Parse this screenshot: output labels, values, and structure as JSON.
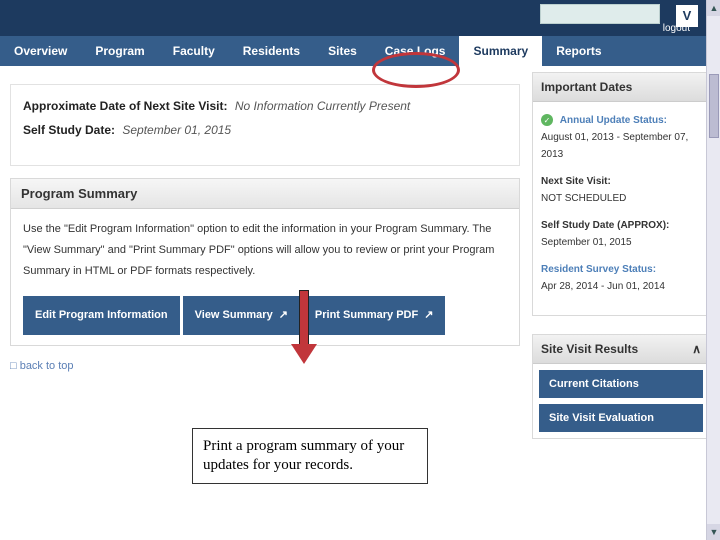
{
  "topbar": {
    "logout": "logout",
    "v": "V"
  },
  "nav": {
    "tabs": [
      "Overview",
      "Program",
      "Faculty",
      "Residents",
      "Sites",
      "Case Logs",
      "Summary",
      "Reports"
    ],
    "activeIndex": 6
  },
  "info": {
    "nextVisitLabel": "Approximate Date of Next Site Visit:",
    "nextVisitValue": "No Information Currently Present",
    "selfStudyLabel": "Self Study Date:",
    "selfStudyValue": "September 01, 2015"
  },
  "summary": {
    "title": "Program Summary",
    "help": "Use the \"Edit Program Information\" option to edit the information in your Program Summary. The \"View Summary\" and \"Print Summary PDF\" options will allow you to review or print your Program Summary in HTML or PDF formats respectively.",
    "editBtn": "Edit Program Information",
    "viewBtn": "View Summary",
    "printBtn": "Print Summary PDF"
  },
  "backtop": "□ back to top",
  "callout": "Print a program summary of your updates for your records.",
  "sidebar": {
    "dates": {
      "title": "Important Dates",
      "status": {
        "label": "Annual Update Status:",
        "value": "August 01, 2013 - September 07, 2013"
      },
      "nextVisit": {
        "label": "Next Site Visit:",
        "value": "NOT SCHEDULED"
      },
      "selfStudy": {
        "label": "Self Study Date (APPROX):",
        "value": "September 01, 2015"
      },
      "survey": {
        "label": "Resident Survey Status:",
        "value": "Apr 28, 2014 - Jun 01, 2014"
      }
    },
    "results": {
      "title": "Site Visit Results",
      "citations": "Current Citations",
      "evaluation": "Site Visit Evaluation"
    }
  }
}
